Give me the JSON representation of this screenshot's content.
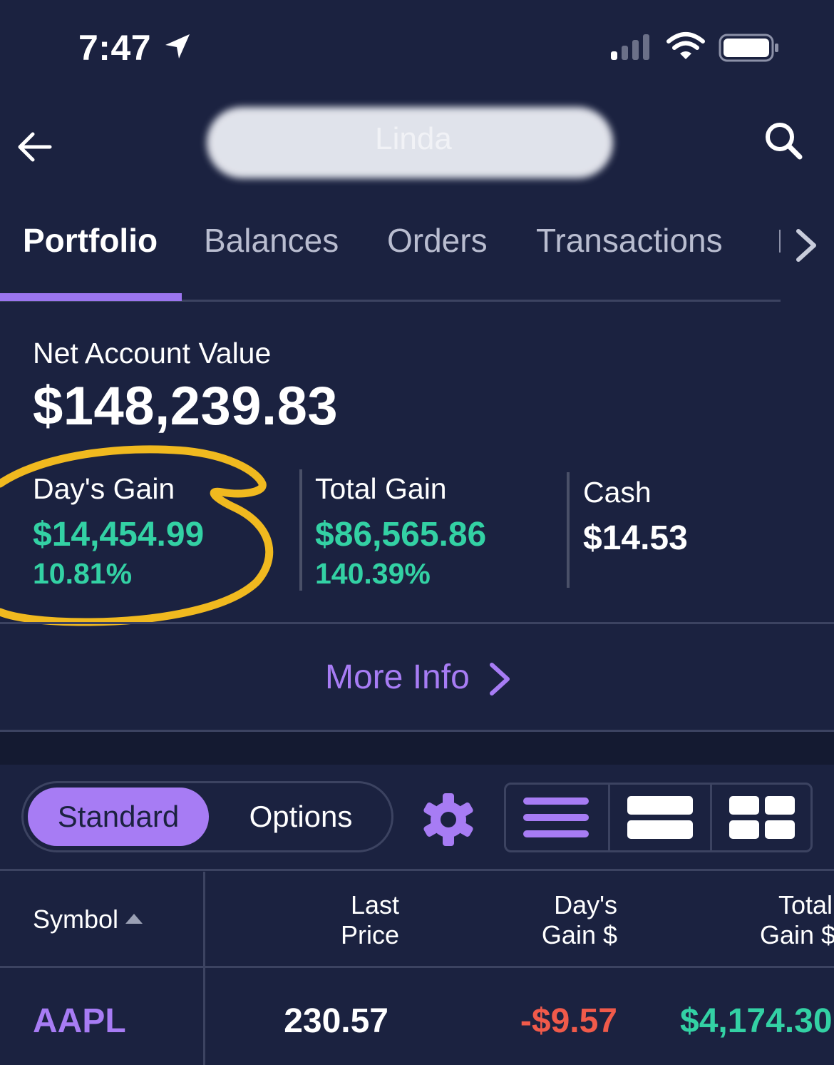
{
  "status_bar": {
    "time": "7:47",
    "icons": [
      "location-arrow-icon",
      "cellular-signal-icon",
      "wifi-icon",
      "battery-icon"
    ]
  },
  "header": {
    "account_name_visible": "Linda",
    "icons": [
      "back-arrow-icon",
      "search-icon"
    ]
  },
  "tabs": [
    {
      "label": "Portfolio",
      "active": true
    },
    {
      "label": "Balances",
      "active": false
    },
    {
      "label": "Orders",
      "active": false
    },
    {
      "label": "Transactions",
      "active": false
    }
  ],
  "summary": {
    "net_account_value_label": "Net Account Value",
    "net_account_value": "$148,239.83",
    "days_gain_label": "Day's Gain",
    "days_gain_value": "$14,454.99",
    "days_gain_pct": "10.81%",
    "total_gain_label": "Total Gain",
    "total_gain_value": "$86,565.86",
    "total_gain_pct": "140.39%",
    "cash_label": "Cash",
    "cash_value": "$14.53"
  },
  "more_info": {
    "label": "More Info"
  },
  "segmented": {
    "standard": "Standard",
    "options": "Options",
    "selected": "Standard"
  },
  "view_modes": [
    "list-view-icon",
    "card-view-icon",
    "grid-view-icon"
  ],
  "table": {
    "headers": {
      "symbol": "Symbol",
      "last_price": [
        "Last",
        "Price"
      ],
      "days_gain": [
        "Day's",
        "Gain $"
      ],
      "total_gain": [
        "Total",
        "Gain $"
      ]
    },
    "rows": [
      {
        "symbol": "AAPL",
        "last_price": "230.57",
        "days_gain": "-$9.57",
        "total_gain": "$4,174.30"
      }
    ]
  },
  "colors": {
    "background": "#1b2240",
    "accent": "#a77cf4",
    "gain": "#33d1a4",
    "loss": "#f05a4a",
    "annotation": "#f0b91f"
  }
}
